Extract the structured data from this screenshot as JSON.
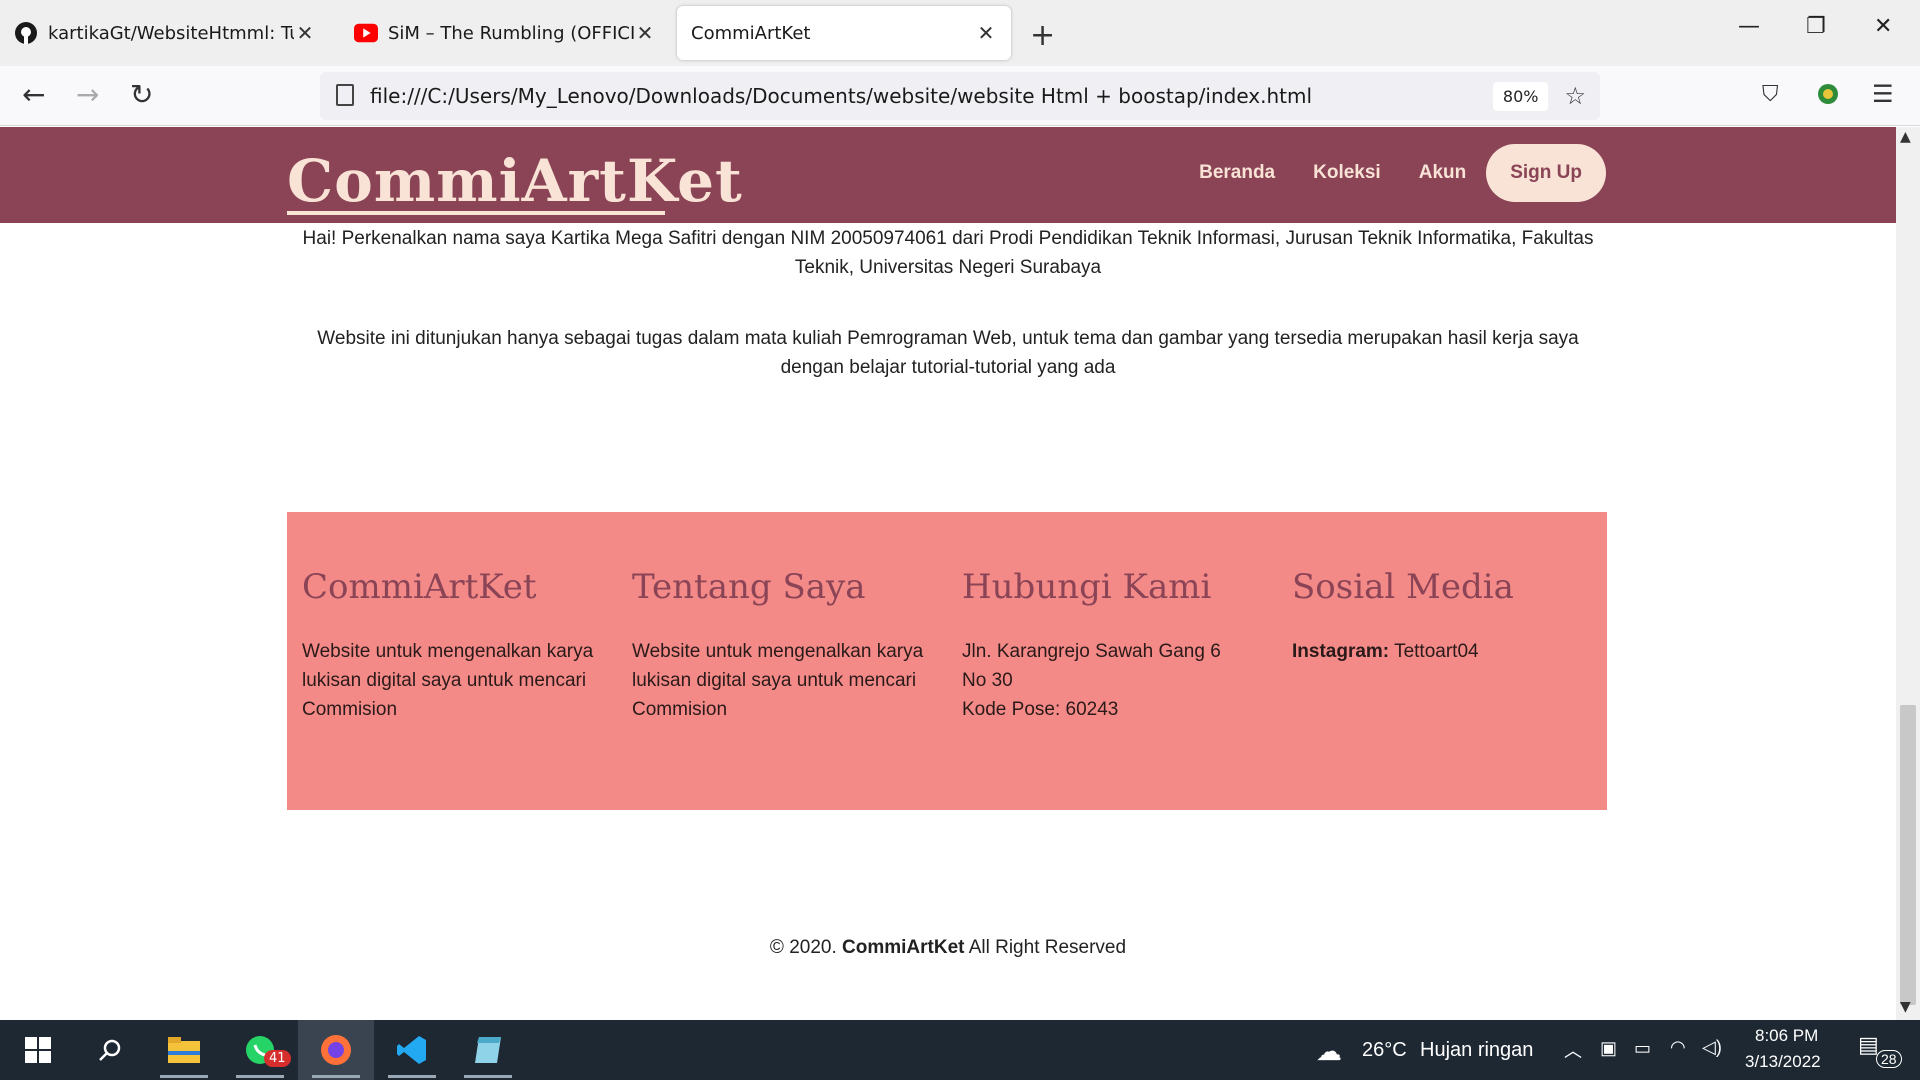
{
  "browser": {
    "tabs": [
      {
        "label": "kartikaGt/WebsiteHtmml: Tugas",
        "icon": "github-icon"
      },
      {
        "label": "SiM – The Rumbling (OFFICIAL V",
        "icon": "youtube-icon"
      },
      {
        "label": "CommiArtKet",
        "icon": "",
        "active": true
      }
    ],
    "new_tab_glyph": "+",
    "url": "file:///C:/Users/My_Lenovo/Downloads/Documents/website/website Html + boostap/index.html",
    "zoom": "80%"
  },
  "site": {
    "brand": "CommiArtKet",
    "nav": {
      "beranda": "Beranda",
      "koleksi": "Koleksi",
      "akun": "Akun",
      "signup": "Sign Up"
    },
    "about": {
      "p1": "Hai! Perkenalkan nama saya Kartika Mega Safitri dengan NIM 20050974061 dari Prodi Pendidikan Teknik Informasi, Jurusan Teknik Informatika, Fakultas Teknik, Universitas Negeri Surabaya",
      "p2": "Website ini ditunjukan hanya sebagai tugas dalam mata kuliah Pemrograman Web, untuk tema dan gambar yang tersedia merupakan hasil kerja saya dengan belajar tutorial-tutorial yang ada"
    },
    "footer": {
      "col1": {
        "title": "CommiArtKet",
        "text": "Website untuk mengenalkan karya lukisan digital saya untuk mencari Commision"
      },
      "col2": {
        "title": "Tentang Saya",
        "text": "Website untuk mengenalkan karya lukisan digital saya untuk mencari Commision"
      },
      "col3": {
        "title": "Hubungi Kami",
        "line1": "Jln. Karangrejo Sawah Gang 6",
        "line2": "No 30",
        "line3": "Kode Pose: 60243"
      },
      "col4": {
        "title": "Sosial Media",
        "label": "Instagram:",
        "value": "Tettoart04"
      }
    },
    "copyright": {
      "prefix": "© 2020.",
      "brand": "CommiArtKet",
      "suffix": "All Right Reserved"
    },
    "colors": {
      "nav_bg": "#8a4456",
      "cream": "#f9e3d6",
      "footer_bg": "#f48a87"
    }
  },
  "taskbar": {
    "whatsapp_badge": "41",
    "weather": "26°C",
    "weather_desc": "Hujan ringan",
    "time": "8:06 PM",
    "date": "3/13/2022",
    "notifications": "28"
  }
}
